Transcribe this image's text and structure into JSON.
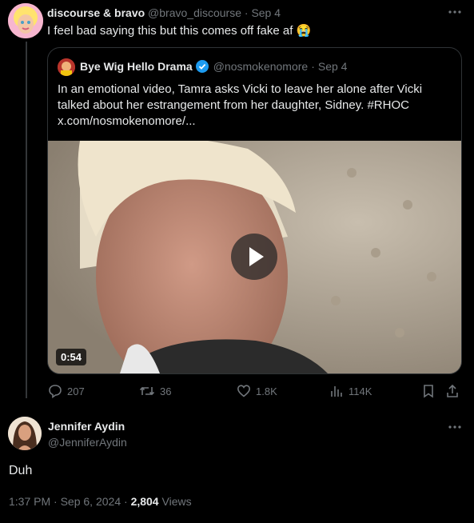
{
  "tweet": {
    "author_name": "discourse & bravo",
    "handle": "@bravo_discourse",
    "date": "Sep 4",
    "text": "I feel bad saying this but this comes off fake af 😭",
    "more_icon": "ellipsis-icon"
  },
  "quoted": {
    "author_name": "Bye Wig Hello Drama",
    "verified": true,
    "handle": "@nosmokenomore",
    "date": "Sep 4",
    "text_line1": "In an emotional video, Tamra asks Vicki to leave her alone after Vicki",
    "text_line2": "talked about her estrangement from her daughter, Sidney. #RHOC",
    "text_line3": "x.com/nosmokenomore/...",
    "video_duration": "0:54"
  },
  "actions": {
    "replies": "207",
    "retweets": "36",
    "likes": "1.8K",
    "views": "114K"
  },
  "reply": {
    "author_name": "Jennifer Aydin",
    "handle": "@JenniferAydin",
    "text": "Duh",
    "time": "1:37 PM",
    "date": "Sep 6, 2024",
    "views_count": "2,804",
    "views_label": "Views"
  },
  "colors": {
    "background": "#000000",
    "text": "#e7e9ea",
    "muted": "#71767b",
    "verified": "#1d9bf0",
    "border": "#2f3336"
  }
}
